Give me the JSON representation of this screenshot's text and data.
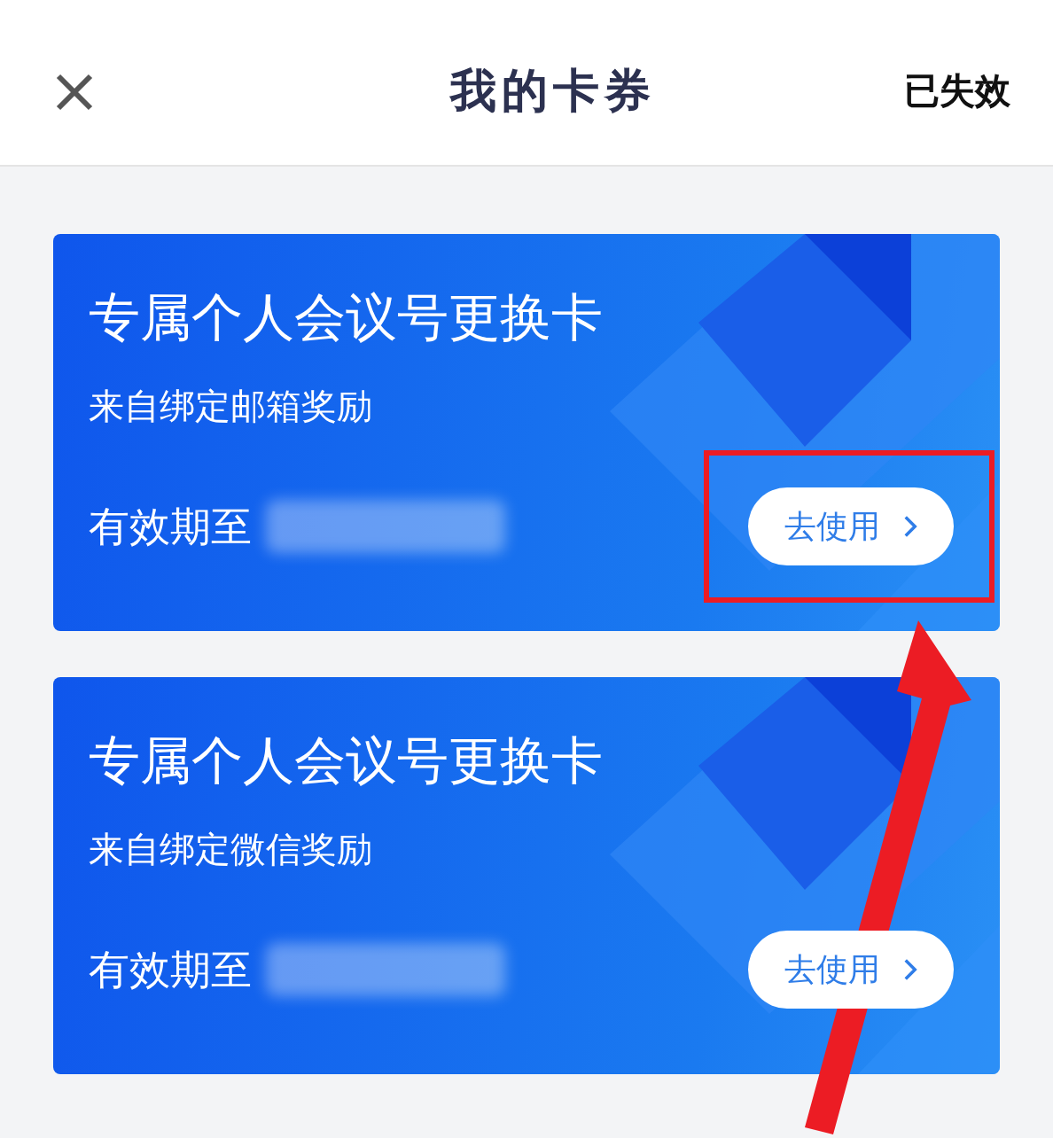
{
  "header": {
    "title": "我的卡券",
    "action": "已失效"
  },
  "cards": [
    {
      "title": "专属个人会议号更换卡",
      "source": "来自绑定邮箱奖励",
      "expiry_label": "有效期至",
      "button": "去使用",
      "highlighted": true
    },
    {
      "title": "专属个人会议号更换卡",
      "source": "来自绑定微信奖励",
      "expiry_label": "有效期至",
      "button": "去使用",
      "highlighted": false
    }
  ]
}
